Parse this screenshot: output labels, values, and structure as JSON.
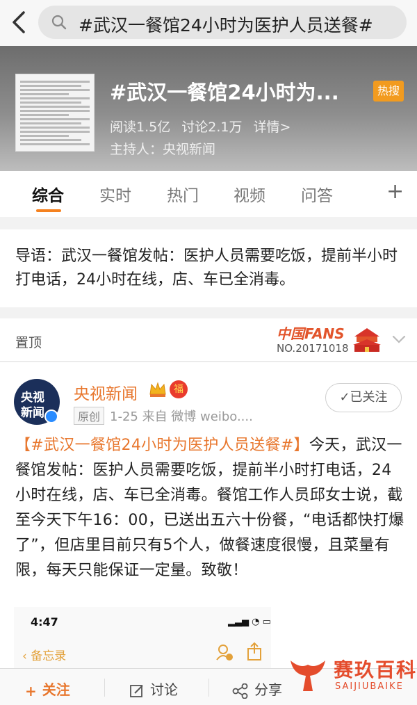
{
  "search": {
    "query": "#武汉一餐馆24小时为医护人员送餐#"
  },
  "topic": {
    "title": "#武汉一餐馆24小时为...",
    "hot_badge": "热搜",
    "reads": "阅读1.5亿",
    "discussions": "讨论2.1万",
    "details": "详情>",
    "host": "主持人：央视新闻"
  },
  "tabs": [
    {
      "label": "综合",
      "active": true
    },
    {
      "label": "实时"
    },
    {
      "label": "热门"
    },
    {
      "label": "视频"
    },
    {
      "label": "问答"
    }
  ],
  "intro": {
    "text": "导语：武汉一餐馆发帖：医护人员需要吃饭，提前半小时打电话，24小时在线，店、车已全消毒。"
  },
  "pinned": {
    "label": "置顶",
    "fans_title": "中国FANS",
    "fans_no": "NO.20171018"
  },
  "post": {
    "avatar_line1": "央视",
    "avatar_line2": "新闻",
    "username": "央视新闻",
    "fu_badge": "福",
    "original_tag": "原创",
    "meta": "1-25  来自 微博 weibo....",
    "follow_label": "✓已关注",
    "hashtag": "【#武汉一餐馆24小时为医护人员送餐#】",
    "text": "今天，武汉一餐馆发帖：医护人员需要吃饭，提前半小时打电话，24小时在线，店、车已全消毒。餐馆工作人员邱女士说，截至今天下午16：00，已送出五六十份餐，“电话都快打爆了”，但店里目前只有5个人，做餐速度很慢，且菜量有限，每天只能保证一定量。致敬！"
  },
  "embed": {
    "time": "4:47",
    "back_label": "备忘录"
  },
  "bottom": {
    "follow": "关注",
    "comment": "讨论",
    "share": "分享"
  },
  "watermark": {
    "cn": "赛玖百科",
    "en": "SAIJIUBAIKE"
  },
  "colors": {
    "accent": "#e8772e",
    "hot": "#f29b1f",
    "tab_underline": "#f58220"
  }
}
